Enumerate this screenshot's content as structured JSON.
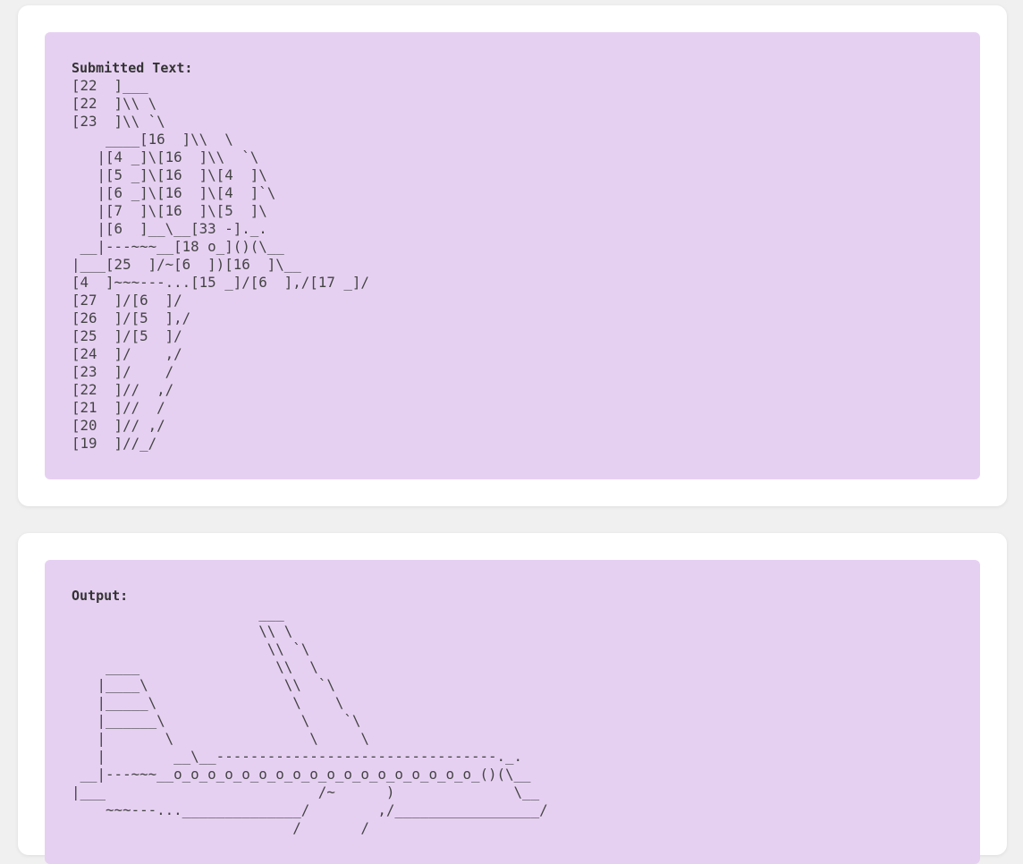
{
  "submitted": {
    "label": "Submitted Text:",
    "text": "[22  ]___\n[22  ]\\\\ \\\n[23  ]\\\\ `\\\n    ____[16  ]\\\\  \\\n   |[4 _]\\[16  ]\\\\  `\\\n   |[5 _]\\[16  ]\\[4  ]\\\n   |[6 _]\\[16  ]\\[4  ]`\\\n   |[7  ]\\[16  ]\\[5  ]\\\n   |[6  ]__\\__[33 -]._.\n __|---~~~__[18 o_]()(\\__\n|___[25  ]/~[6  ])[16  ]\\__\n[4  ]~~~---...[15 _]/[6  ],/[17 _]/\n[27  ]/[6  ]/\n[26  ]/[5  ],/\n[25  ]/[5  ]/\n[24  ]/    ,/\n[23  ]/    /\n[22  ]//  ,/\n[21  ]//  /\n[20  ]// ,/\n[19  ]//_/"
  },
  "output": {
    "label": "Output:",
    "text": "                      ___\n                      \\\\ \\\n                       \\\\ `\\\n    ____                \\\\  \\\n   |____\\                \\\\  `\\\n   |_____\\                \\    \\\n   |______\\                \\    `\\\n   |       \\                \\     \\\n   |        __\\__---------------------------------._.\n __|---~~~__o_o_o_o_o_o_o_o_o_o_o_o_o_o_o_o_o_o_()(\\__\n|___                         /~      )              \\__\n    ~~~---...______________/        ,/_________________/\n                          /       /"
  }
}
